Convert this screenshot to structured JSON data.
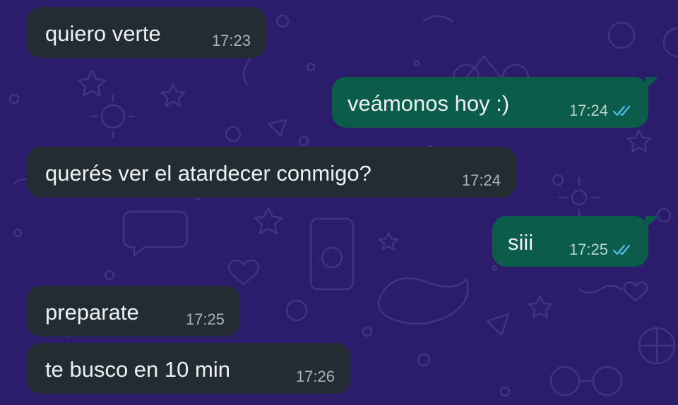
{
  "messages": [
    {
      "direction": "in",
      "text": "quiero verte",
      "time": "17:23"
    },
    {
      "direction": "out",
      "text": "veámonos hoy :)",
      "time": "17:24",
      "status": "read"
    },
    {
      "direction": "in",
      "text": "querés ver el atardecer conmigo?",
      "time": "17:24"
    },
    {
      "direction": "out",
      "text": "siii",
      "time": "17:25",
      "status": "read"
    },
    {
      "direction": "in",
      "text": "preparate",
      "time": "17:25"
    },
    {
      "direction": "in",
      "text": "te busco en 10 min",
      "time": "17:26"
    }
  ],
  "colors": {
    "background": "#2b1d6b",
    "incoming_bubble": "#222c32",
    "outgoing_bubble": "#0b5c4a",
    "read_tick": "#53bdeb"
  },
  "icons": {
    "read_receipt": "double-check-icon",
    "wallpaper": "doodle-pattern"
  }
}
